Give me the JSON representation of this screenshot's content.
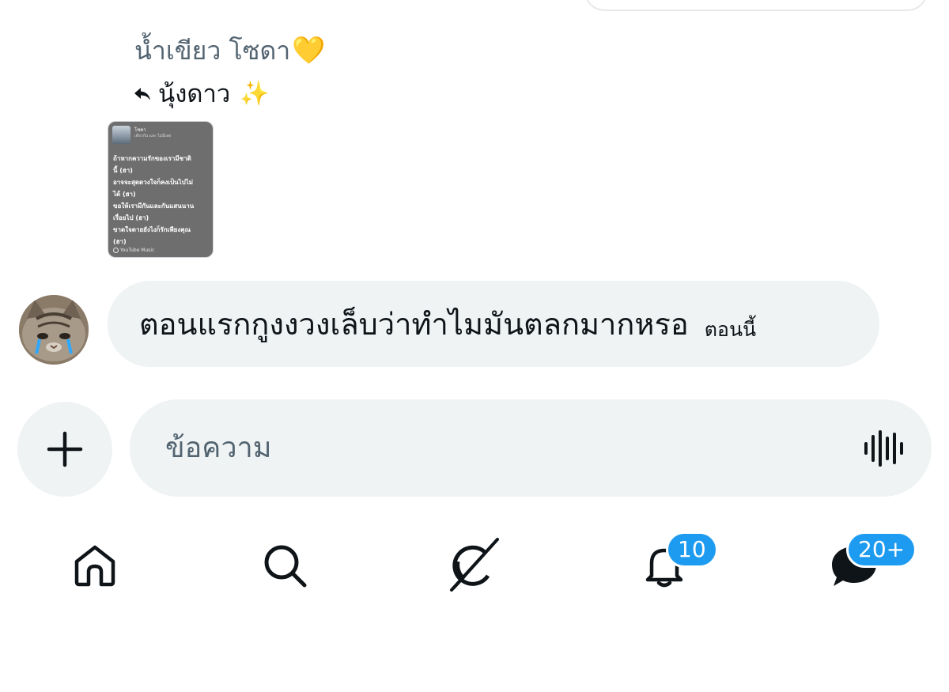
{
  "reply_context": {
    "replying_to": "น้ำเขียว โซดา",
    "replying_to_emoji": "💛",
    "reply_author": "นุ้งดาว",
    "reply_author_emoji": "✨"
  },
  "shared_card": {
    "song": "โชคา",
    "artist": "เดียวกัน และ ไม่มีเลย",
    "lyrics": [
      "ถ้าหากความรักของเรามีชาติ",
      "นี้ (ฮา)",
      "อาจจะสุดดวงใจก็คงเป็นไปไม่",
      "ได้ (ฮา)",
      "ขอให้เรามีกันและกันแสนนาน",
      "เรื่อยไป (ฮา)",
      "ขาดใจตายยังไงก็รักเพียงคุณ",
      "(ฮา)"
    ],
    "brand": "YouTube Music"
  },
  "message": {
    "text": "ตอนแรกกูงงวงเล็บว่าทำไมมันตลกมากหรอ",
    "time": "ตอนนี้"
  },
  "composer": {
    "placeholder": "ข้อความ",
    "value": ""
  },
  "nav": {
    "notifications_badge": "10",
    "messages_badge": "20+"
  },
  "colors": {
    "accent": "#1d9bf0",
    "bubble_bg": "#eff3f4",
    "muted_text": "#536471"
  }
}
